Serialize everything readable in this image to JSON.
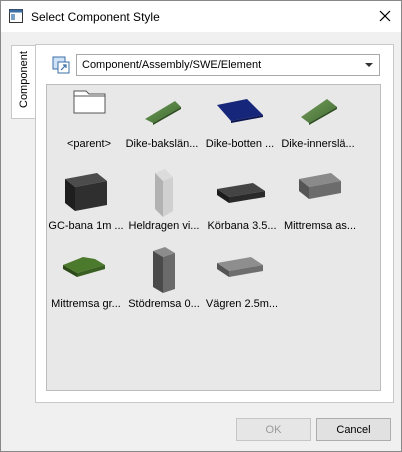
{
  "window": {
    "title": "Select Component Style",
    "close_glyph": "✕"
  },
  "side_tab": {
    "label": "Component"
  },
  "path": {
    "value": "Component/Assembly/SWE/Element"
  },
  "items": [
    {
      "label": "<parent>",
      "icon": "folder-icon"
    },
    {
      "label": "Dike-bakslän...",
      "icon": "green-slope-icon"
    },
    {
      "label": "Dike-botten ...",
      "icon": "blue-plane-icon"
    },
    {
      "label": "Dike-innerslä...",
      "icon": "green-slope-icon"
    },
    {
      "label": "GC-bana 1m ...",
      "icon": "dark-block-icon"
    },
    {
      "label": "Heldragen vi...",
      "icon": "light-wall-icon"
    },
    {
      "label": "Körbana 3.5...",
      "icon": "dark-slab-icon"
    },
    {
      "label": "Mittremsa as...",
      "icon": "gray-slab-icon"
    },
    {
      "label": "Mittremsa gr...",
      "icon": "green-island-icon"
    },
    {
      "label": "Stödremsa 0...",
      "icon": "gray-pillar-icon"
    },
    {
      "label": "Vägren 2.5m...",
      "icon": "gray-slab-icon"
    }
  ],
  "buttons": {
    "ok": "OK",
    "cancel": "Cancel"
  }
}
